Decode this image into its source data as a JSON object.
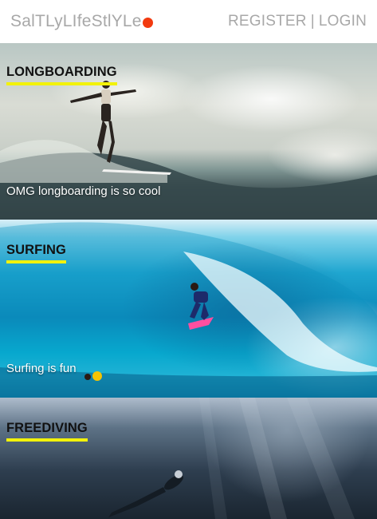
{
  "header": {
    "logo_text": "SalTLyLIfeStlYLe",
    "register_label": "REGISTER",
    "separator": "|",
    "login_label": "LOGIN"
  },
  "cards": [
    {
      "title": "LONGBOARDING",
      "caption": "OMG longboarding is so cool"
    },
    {
      "title": "SURFING",
      "caption": "Surfing is fun"
    },
    {
      "title": "FREEDIVING",
      "caption": ""
    }
  ],
  "colors": {
    "logo_dot": "#f23a0f",
    "title_underline": "#f2f20a",
    "header_text": "#a8a8a8"
  }
}
